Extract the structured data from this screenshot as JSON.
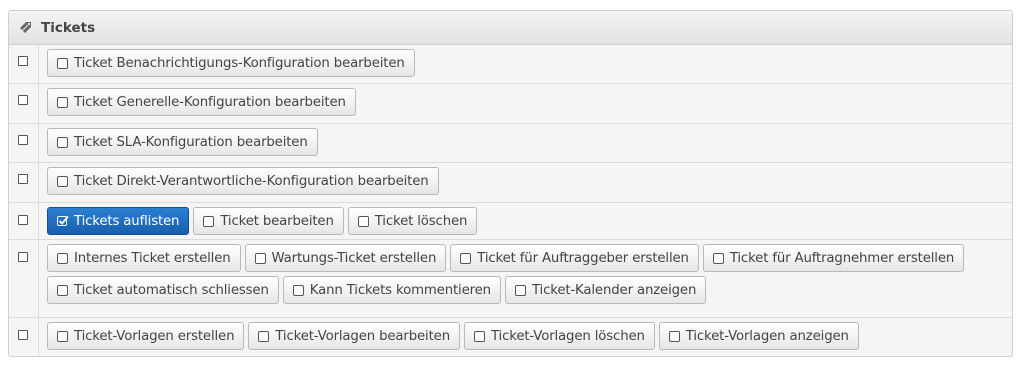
{
  "header": {
    "title": "Tickets",
    "icon": "tag-icon"
  },
  "rows": [
    {
      "buttons": [
        {
          "label": "Ticket Benachrichtigungs-Konfiguration bearbeiten",
          "checked": false
        }
      ]
    },
    {
      "buttons": [
        {
          "label": "Ticket Generelle-Konfiguration bearbeiten",
          "checked": false
        }
      ]
    },
    {
      "buttons": [
        {
          "label": "Ticket SLA-Konfiguration bearbeiten",
          "checked": false
        }
      ]
    },
    {
      "buttons": [
        {
          "label": "Ticket Direkt-Verantwortliche-Konfiguration bearbeiten",
          "checked": false
        }
      ]
    },
    {
      "buttons": [
        {
          "label": "Tickets auflisten",
          "checked": true
        },
        {
          "label": "Ticket bearbeiten",
          "checked": false
        },
        {
          "label": "Ticket löschen",
          "checked": false
        }
      ]
    },
    {
      "buttons": [
        {
          "label": "Internes Ticket erstellen",
          "checked": false
        },
        {
          "label": "Wartungs-Ticket erstellen",
          "checked": false
        },
        {
          "label": "Ticket für Auftraggeber erstellen",
          "checked": false
        },
        {
          "label": "Ticket für Auftragnehmer erstellen",
          "checked": false
        },
        {
          "label": "Ticket automatisch schliessen",
          "checked": false
        },
        {
          "label": "Kann Tickets kommentieren",
          "checked": false
        },
        {
          "label": "Ticket-Kalender anzeigen",
          "checked": false
        }
      ]
    },
    {
      "buttons": [
        {
          "label": "Ticket-Vorlagen erstellen",
          "checked": false
        },
        {
          "label": "Ticket-Vorlagen bearbeiten",
          "checked": false
        },
        {
          "label": "Ticket-Vorlagen löschen",
          "checked": false
        },
        {
          "label": "Ticket-Vorlagen anzeigen",
          "checked": false
        }
      ]
    }
  ],
  "colors": {
    "active": "#1f6dc2",
    "border": "#cfcfcf"
  }
}
